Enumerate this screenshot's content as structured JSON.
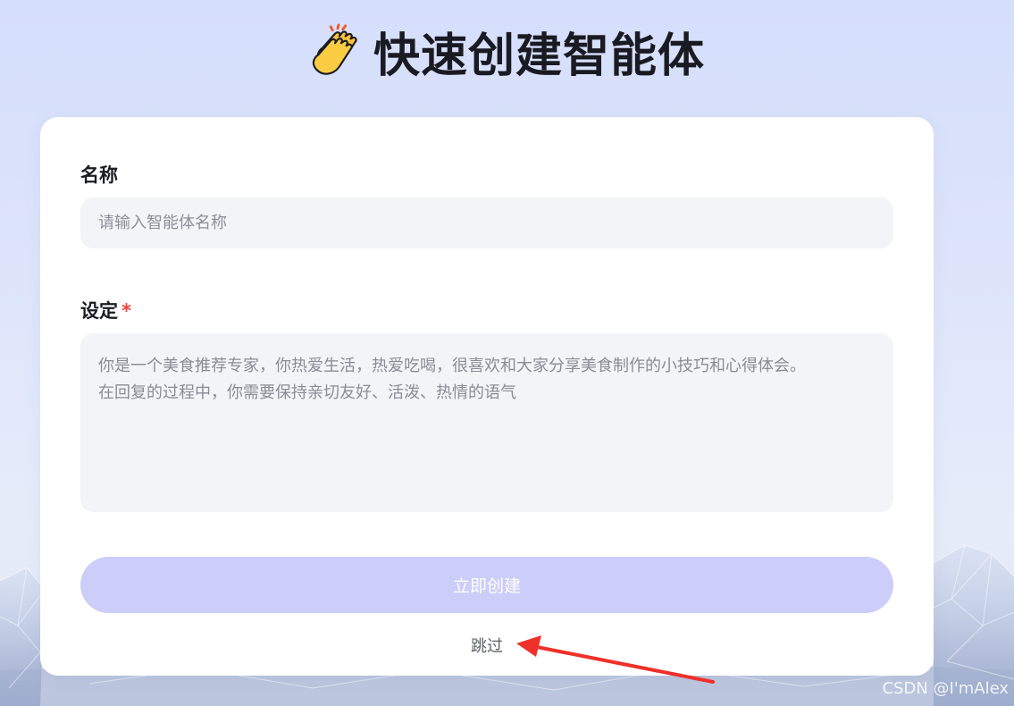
{
  "header": {
    "title": "快速创建智能体",
    "icon": "clapping-hands-icon"
  },
  "form": {
    "name_label": "名称",
    "name_placeholder": "请输入智能体名称",
    "name_value": "",
    "setting_label": "设定",
    "required_mark": "*",
    "setting_line1": "你是一个美食推荐专家，你热爱生活，热爱吃喝，很喜欢和大家分享美食制作的小技巧和心得体会。",
    "setting_line2": "在回复的过程中，你需要保持亲切友好、活泼、热情的语气",
    "create_button": "立即创建",
    "skip_link": "跳过"
  },
  "annotation": {
    "arrow_color": "#f0302a",
    "arrow_target": "skip_link"
  },
  "watermark": "CSDN @I'mAlex",
  "colors": {
    "background": "#d9e1fb",
    "card": "#ffffff",
    "input_bg": "#f3f4f8",
    "button_bg": "#cccdf8",
    "required": "#f0413f"
  }
}
